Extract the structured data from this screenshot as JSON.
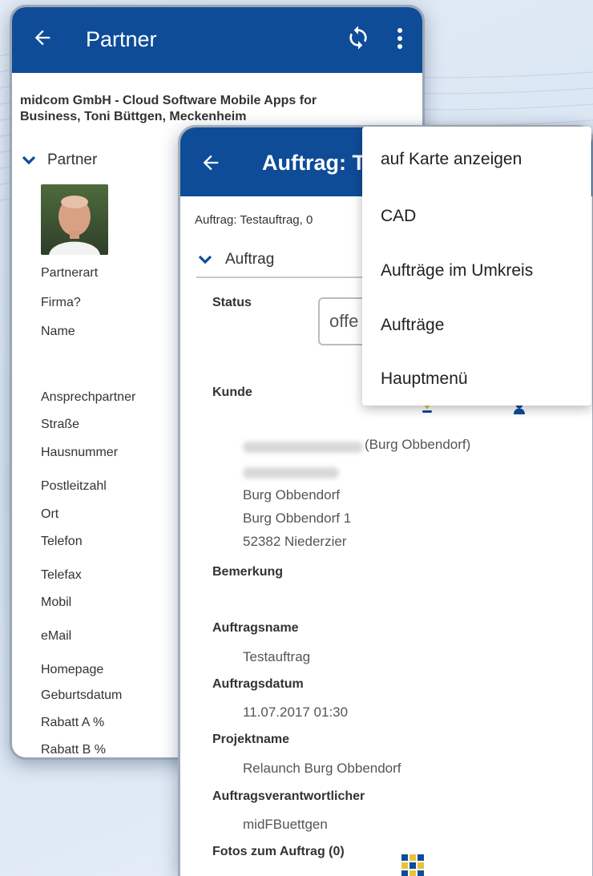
{
  "background": {
    "accent": "#0e4c97",
    "base": "#dfe8f3"
  },
  "partner": {
    "title": "Partner",
    "subtitle_line1": "midcom GmbH - Cloud Software Mobile Apps for",
    "subtitle_line2": "Business, Toni Büttgen, Meckenheim",
    "section": "Partner",
    "fields": [
      "Partnerart",
      "Firma?",
      "Name",
      "Ansprechpartner",
      "Straße",
      "Hausnummer",
      "Postleitzahl",
      "Ort",
      "Telefon",
      "Telefax",
      "Mobil",
      "eMail",
      "Homepage",
      "Geburtsdatum",
      "Rabatt A %",
      "Rabatt B %"
    ],
    "icons": {
      "back": "back-arrow-icon",
      "refresh": "refresh-icon",
      "more": "more-vert-icon"
    }
  },
  "auftrag": {
    "title": "Auftrag: T",
    "subtitle": "Auftrag: Testauftrag, 0",
    "section": "Auftrag",
    "status_label": "Status",
    "status_value": "offe",
    "kunde_label": "Kunde",
    "kunde_suffix": "(Burg Obbendorf)",
    "address": [
      "Burg Obbendorf",
      "Burg Obbendorf 1",
      "52382 Niederzier"
    ],
    "bemerkung_label": "Bemerkung",
    "auftragsname_label": "Auftragsname",
    "auftragsname_value": "Testauftrag",
    "auftragsdatum_label": "Auftragsdatum",
    "auftragsdatum_value": "11.07.2017 01:30",
    "projektname_label": "Projektname",
    "projektname_value": "Relaunch Burg Obbendorf",
    "verantwortlich_label": "Auftragsverantwortlicher",
    "verantwortlich_value": "midFBuettgen",
    "fotos_label": "Fotos zum Auftrag (0)"
  },
  "menu": {
    "items": [
      "auf Karte anzeigen",
      "CAD",
      "Aufträge im Umkreis",
      "Aufträge",
      "Hauptmenü"
    ]
  }
}
